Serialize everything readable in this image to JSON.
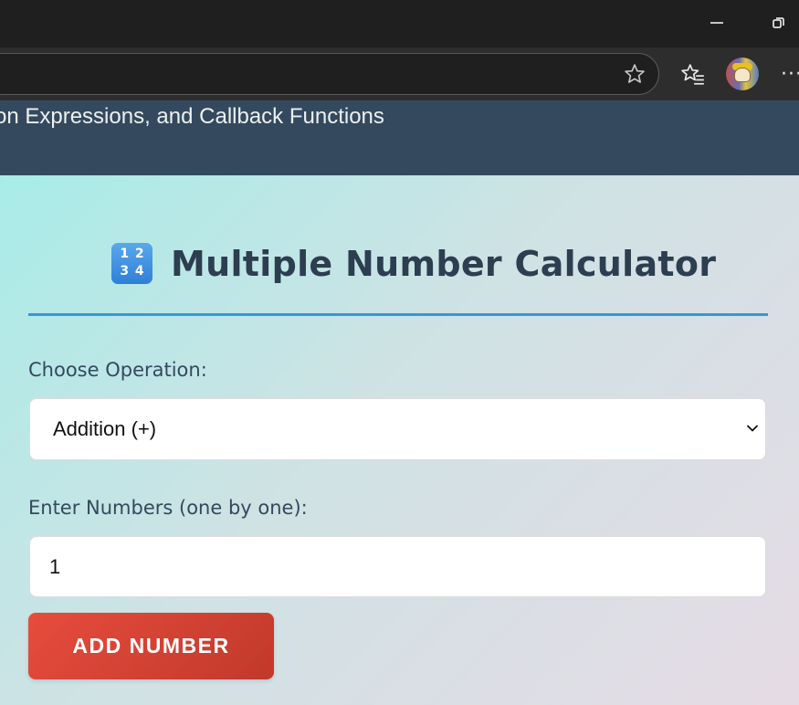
{
  "browser": {
    "icons": {
      "minimize": "minimize-icon",
      "restore": "restore-icon",
      "favorite": "star-icon",
      "favorites": "favorites-icon",
      "more": "more-icon"
    },
    "more_glyph": "···"
  },
  "page": {
    "header_subtitle": "on Expressions, and Callback Functions",
    "title": "Multiple Number Calculator",
    "title_emoji": [
      "1",
      "2",
      "3",
      "4"
    ],
    "operation_label": "Choose Operation:",
    "operation_selected": "Addition (+)",
    "numbers_label": "Enter Numbers (one by one):",
    "number_input_value": "1",
    "add_button_label": "ADD NUMBER"
  },
  "colors": {
    "header_bg": "#34495e",
    "accent_rule": "#3498db",
    "button_red": "#e74c3c",
    "text_dark": "#2c3e50"
  }
}
